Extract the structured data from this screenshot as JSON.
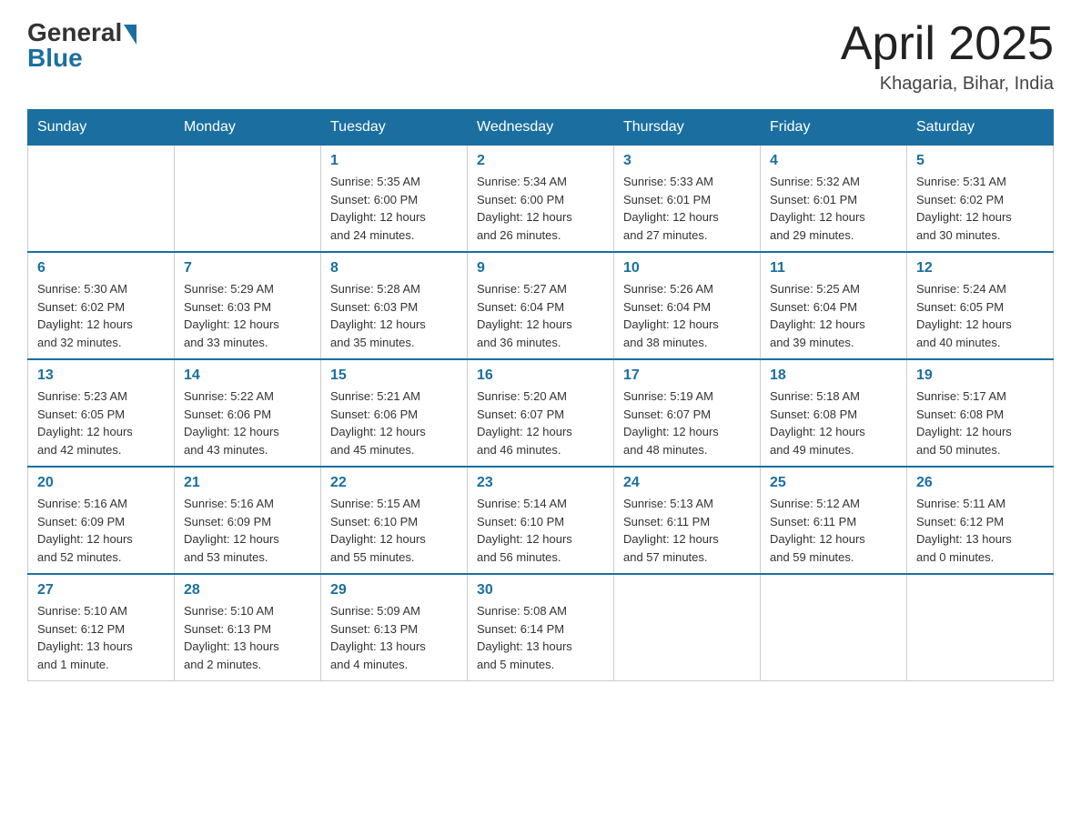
{
  "header": {
    "logo_general": "General",
    "logo_blue": "Blue",
    "month_year": "April 2025",
    "location": "Khagaria, Bihar, India"
  },
  "days_of_week": [
    "Sunday",
    "Monday",
    "Tuesday",
    "Wednesday",
    "Thursday",
    "Friday",
    "Saturday"
  ],
  "weeks": [
    [
      {
        "day": "",
        "info": ""
      },
      {
        "day": "",
        "info": ""
      },
      {
        "day": "1",
        "info": "Sunrise: 5:35 AM\nSunset: 6:00 PM\nDaylight: 12 hours\nand 24 minutes."
      },
      {
        "day": "2",
        "info": "Sunrise: 5:34 AM\nSunset: 6:00 PM\nDaylight: 12 hours\nand 26 minutes."
      },
      {
        "day": "3",
        "info": "Sunrise: 5:33 AM\nSunset: 6:01 PM\nDaylight: 12 hours\nand 27 minutes."
      },
      {
        "day": "4",
        "info": "Sunrise: 5:32 AM\nSunset: 6:01 PM\nDaylight: 12 hours\nand 29 minutes."
      },
      {
        "day": "5",
        "info": "Sunrise: 5:31 AM\nSunset: 6:02 PM\nDaylight: 12 hours\nand 30 minutes."
      }
    ],
    [
      {
        "day": "6",
        "info": "Sunrise: 5:30 AM\nSunset: 6:02 PM\nDaylight: 12 hours\nand 32 minutes."
      },
      {
        "day": "7",
        "info": "Sunrise: 5:29 AM\nSunset: 6:03 PM\nDaylight: 12 hours\nand 33 minutes."
      },
      {
        "day": "8",
        "info": "Sunrise: 5:28 AM\nSunset: 6:03 PM\nDaylight: 12 hours\nand 35 minutes."
      },
      {
        "day": "9",
        "info": "Sunrise: 5:27 AM\nSunset: 6:04 PM\nDaylight: 12 hours\nand 36 minutes."
      },
      {
        "day": "10",
        "info": "Sunrise: 5:26 AM\nSunset: 6:04 PM\nDaylight: 12 hours\nand 38 minutes."
      },
      {
        "day": "11",
        "info": "Sunrise: 5:25 AM\nSunset: 6:04 PM\nDaylight: 12 hours\nand 39 minutes."
      },
      {
        "day": "12",
        "info": "Sunrise: 5:24 AM\nSunset: 6:05 PM\nDaylight: 12 hours\nand 40 minutes."
      }
    ],
    [
      {
        "day": "13",
        "info": "Sunrise: 5:23 AM\nSunset: 6:05 PM\nDaylight: 12 hours\nand 42 minutes."
      },
      {
        "day": "14",
        "info": "Sunrise: 5:22 AM\nSunset: 6:06 PM\nDaylight: 12 hours\nand 43 minutes."
      },
      {
        "day": "15",
        "info": "Sunrise: 5:21 AM\nSunset: 6:06 PM\nDaylight: 12 hours\nand 45 minutes."
      },
      {
        "day": "16",
        "info": "Sunrise: 5:20 AM\nSunset: 6:07 PM\nDaylight: 12 hours\nand 46 minutes."
      },
      {
        "day": "17",
        "info": "Sunrise: 5:19 AM\nSunset: 6:07 PM\nDaylight: 12 hours\nand 48 minutes."
      },
      {
        "day": "18",
        "info": "Sunrise: 5:18 AM\nSunset: 6:08 PM\nDaylight: 12 hours\nand 49 minutes."
      },
      {
        "day": "19",
        "info": "Sunrise: 5:17 AM\nSunset: 6:08 PM\nDaylight: 12 hours\nand 50 minutes."
      }
    ],
    [
      {
        "day": "20",
        "info": "Sunrise: 5:16 AM\nSunset: 6:09 PM\nDaylight: 12 hours\nand 52 minutes."
      },
      {
        "day": "21",
        "info": "Sunrise: 5:16 AM\nSunset: 6:09 PM\nDaylight: 12 hours\nand 53 minutes."
      },
      {
        "day": "22",
        "info": "Sunrise: 5:15 AM\nSunset: 6:10 PM\nDaylight: 12 hours\nand 55 minutes."
      },
      {
        "day": "23",
        "info": "Sunrise: 5:14 AM\nSunset: 6:10 PM\nDaylight: 12 hours\nand 56 minutes."
      },
      {
        "day": "24",
        "info": "Sunrise: 5:13 AM\nSunset: 6:11 PM\nDaylight: 12 hours\nand 57 minutes."
      },
      {
        "day": "25",
        "info": "Sunrise: 5:12 AM\nSunset: 6:11 PM\nDaylight: 12 hours\nand 59 minutes."
      },
      {
        "day": "26",
        "info": "Sunrise: 5:11 AM\nSunset: 6:12 PM\nDaylight: 13 hours\nand 0 minutes."
      }
    ],
    [
      {
        "day": "27",
        "info": "Sunrise: 5:10 AM\nSunset: 6:12 PM\nDaylight: 13 hours\nand 1 minute."
      },
      {
        "day": "28",
        "info": "Sunrise: 5:10 AM\nSunset: 6:13 PM\nDaylight: 13 hours\nand 2 minutes."
      },
      {
        "day": "29",
        "info": "Sunrise: 5:09 AM\nSunset: 6:13 PM\nDaylight: 13 hours\nand 4 minutes."
      },
      {
        "day": "30",
        "info": "Sunrise: 5:08 AM\nSunset: 6:14 PM\nDaylight: 13 hours\nand 5 minutes."
      },
      {
        "day": "",
        "info": ""
      },
      {
        "day": "",
        "info": ""
      },
      {
        "day": "",
        "info": ""
      }
    ]
  ]
}
